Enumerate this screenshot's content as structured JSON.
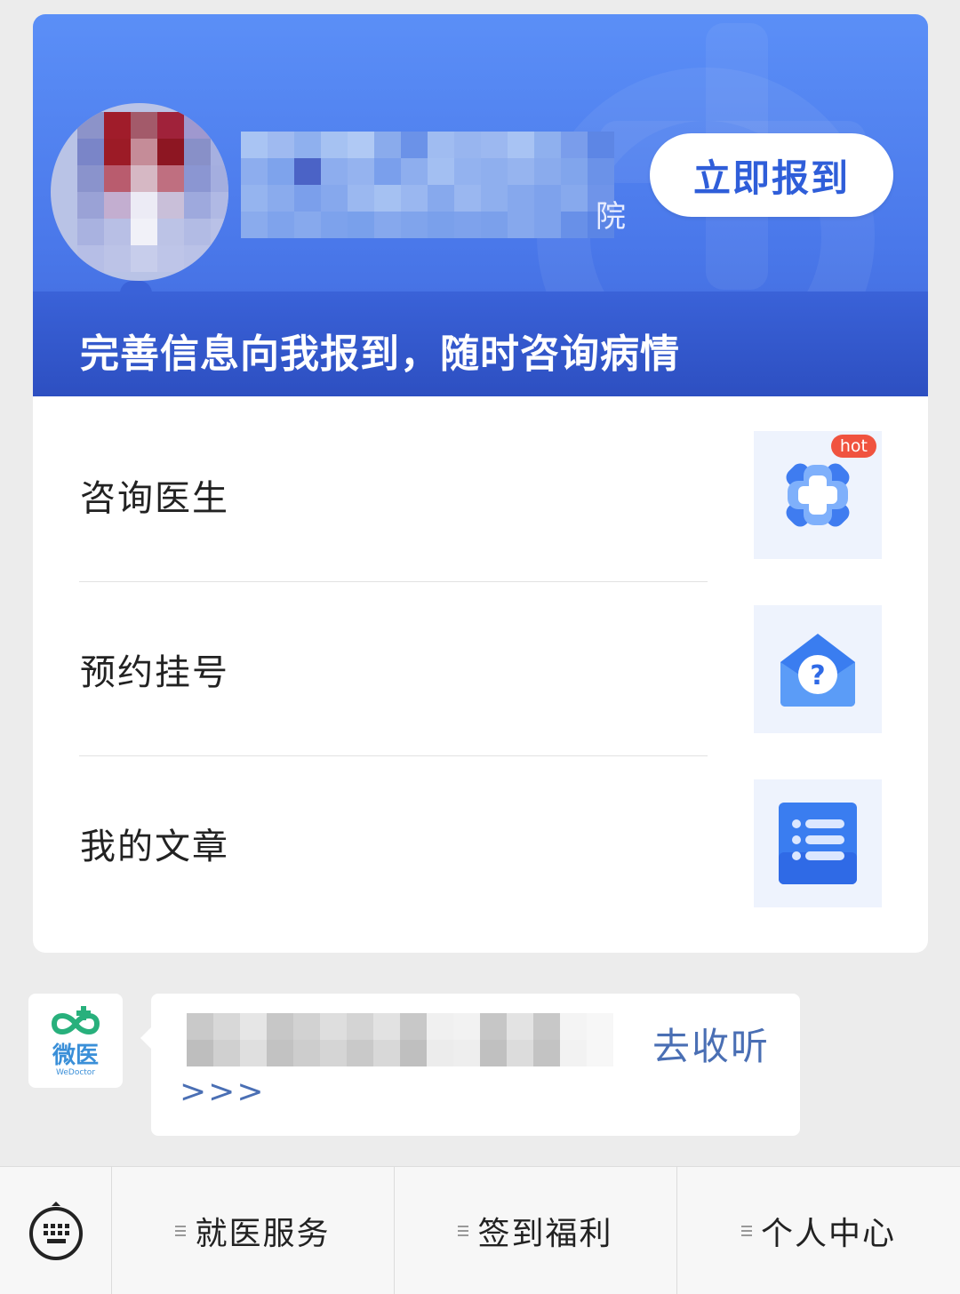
{
  "banner": {
    "hospital_suffix": "院",
    "checkin_button": "立即报到",
    "tagline": "完善信息向我报到，随时咨询病情"
  },
  "menu": [
    {
      "label": "咨询医生",
      "icon": "medical-cross-icon",
      "badge": "hot"
    },
    {
      "label": "预约挂号",
      "icon": "question-envelope-icon"
    },
    {
      "label": "我的文章",
      "icon": "document-list-icon"
    }
  ],
  "message": {
    "sender_brand": "微医",
    "sender_brand_en": "WeDoctor",
    "link_text": "去收听",
    "arrows": ">>>"
  },
  "bottom_bar": {
    "tabs": [
      "就医服务",
      "签到福利",
      "个人中心"
    ]
  }
}
